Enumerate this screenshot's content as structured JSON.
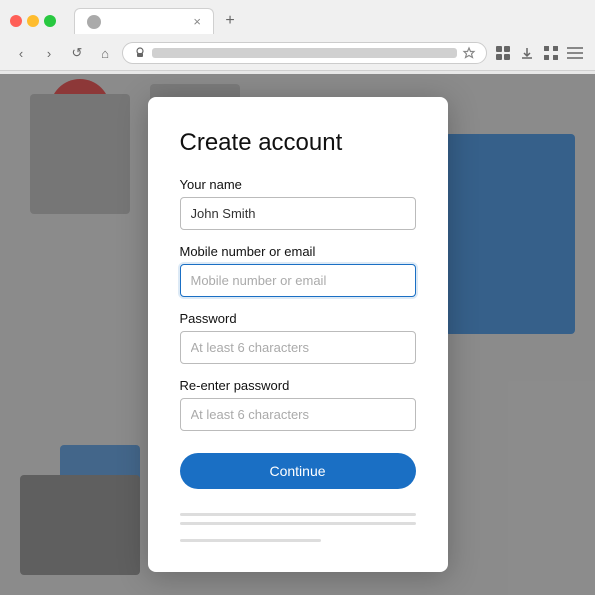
{
  "browser": {
    "tab_title": "",
    "address_bar_text": "",
    "new_tab_icon": "+",
    "nav": {
      "back": "‹",
      "forward": "›",
      "reload": "↺",
      "home": "⌂"
    }
  },
  "modal": {
    "title": "Create account",
    "fields": {
      "name_label": "Your name",
      "name_value": "John Smith",
      "email_label": "Mobile number or email",
      "email_placeholder": "Mobile number or email",
      "password_label": "Password",
      "password_placeholder": "At least 6 characters",
      "reenter_label": "Re-enter password",
      "reenter_placeholder": "At least 6 characters"
    },
    "continue_button": "Continue"
  }
}
